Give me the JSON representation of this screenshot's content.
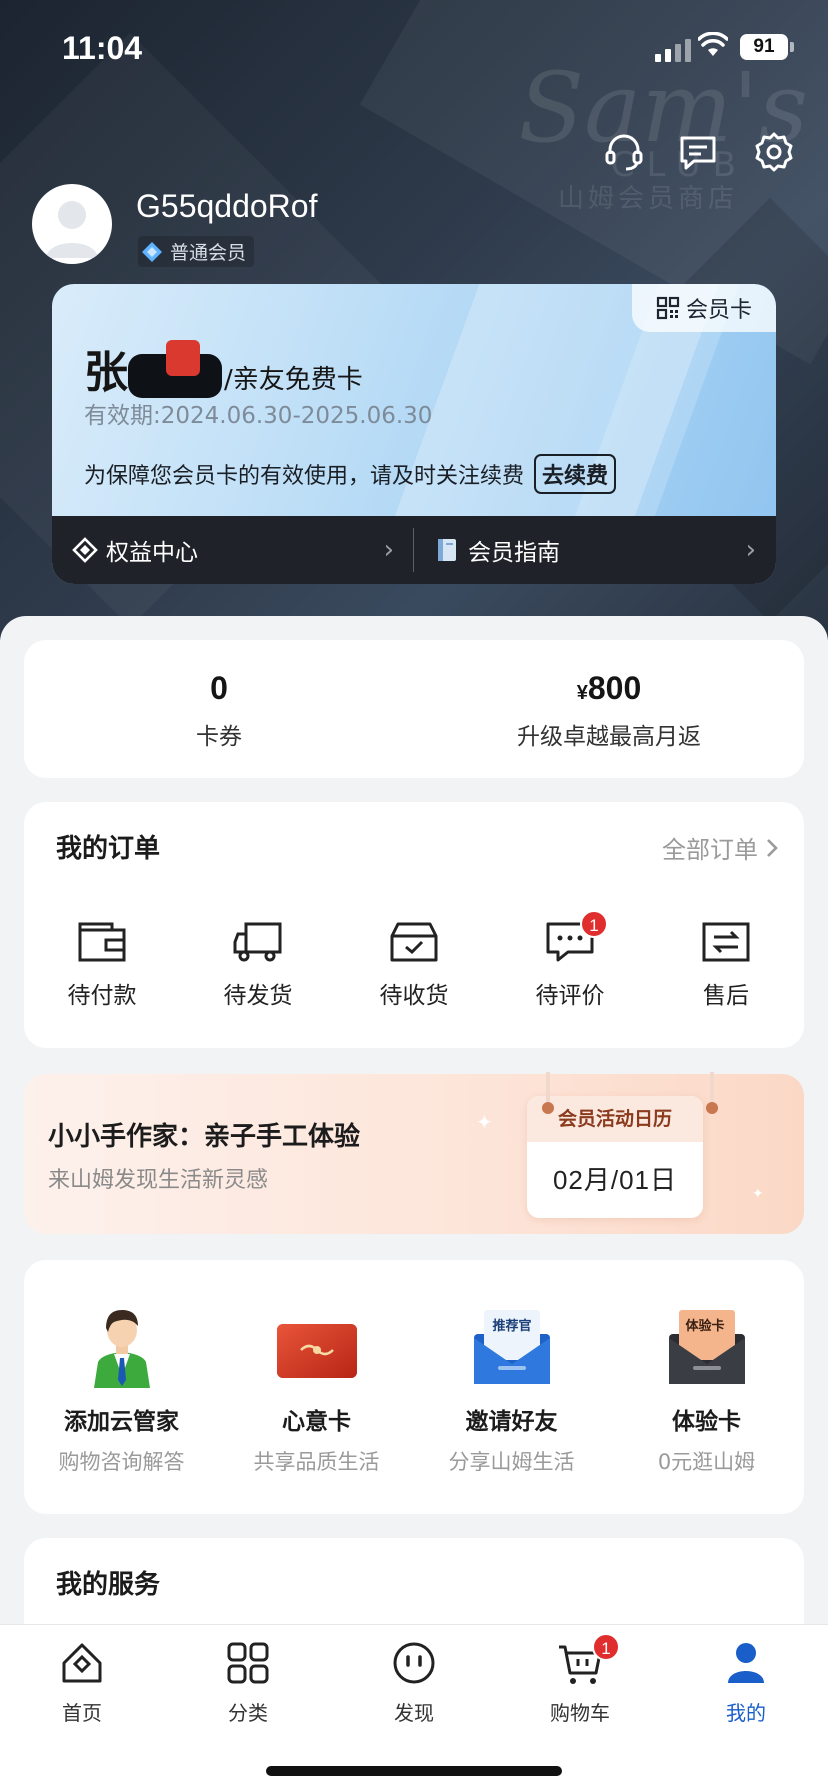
{
  "status_bar": {
    "time": "11:04",
    "battery": "91"
  },
  "header": {
    "brand_watermark": "Sam's",
    "brand_watermark_club": "CLUB",
    "brand_watermark_cn": "山姆会员商店",
    "icons": [
      "headset-icon",
      "message-icon",
      "settings-icon"
    ]
  },
  "profile": {
    "username": "G55qddoRof",
    "member_level": "普通会员"
  },
  "member_card": {
    "qr_label": "会员卡",
    "surname": "张",
    "card_type": "/亲友免费卡",
    "validity": "有效期:2024.06.30-2025.06.30",
    "renew_notice": "为保障您会员卡的有效使用，请及时关注续费",
    "renew_button": "去续费",
    "links": [
      {
        "label": "权益中心",
        "icon": "diamond-icon"
      },
      {
        "label": "会员指南",
        "icon": "book-icon"
      }
    ]
  },
  "stats": [
    {
      "value": "0",
      "currency": "",
      "label": "卡券"
    },
    {
      "value": "800",
      "currency": "¥",
      "label": "升级卓越最高月返"
    }
  ],
  "orders": {
    "title": "我的订单",
    "all_label": "全部订单",
    "items": [
      {
        "label": "待付款",
        "icon": "wallet-icon",
        "badge": ""
      },
      {
        "label": "待发货",
        "icon": "truck-icon",
        "badge": ""
      },
      {
        "label": "待收货",
        "icon": "box-check-icon",
        "badge": ""
      },
      {
        "label": "待评价",
        "icon": "comment-icon",
        "badge": "1"
      },
      {
        "label": "售后",
        "icon": "exchange-icon",
        "badge": ""
      }
    ]
  },
  "activity": {
    "title": "小小手作家：亲子手工体验",
    "subtitle": "来山姆发现生活新灵感",
    "calendar_label": "会员活动日历",
    "date": "02月/01日"
  },
  "services": [
    {
      "name": "添加云管家",
      "desc": "购物咨询解答",
      "icon": "assistant-avatar-icon"
    },
    {
      "name": "心意卡",
      "desc": "共享品质生活",
      "icon": "gift-card-icon"
    },
    {
      "name": "邀请好友",
      "desc": "分享山姆生活",
      "icon": "invite-envelope-icon",
      "tag": "推荐官"
    },
    {
      "name": "体验卡",
      "desc": "0元逛山姆",
      "icon": "trial-card-icon",
      "tag": "体验卡"
    }
  ],
  "my_services": {
    "title": "我的服务"
  },
  "tabbar": {
    "active": "我的",
    "items": [
      {
        "label": "首页",
        "icon": "home-icon",
        "badge": ""
      },
      {
        "label": "分类",
        "icon": "grid-icon",
        "badge": ""
      },
      {
        "label": "发现",
        "icon": "discover-face-icon",
        "badge": ""
      },
      {
        "label": "购物车",
        "icon": "cart-icon",
        "badge": "1"
      },
      {
        "label": "我的",
        "icon": "user-icon",
        "badge": ""
      }
    ]
  },
  "colors": {
    "accent": "#1a5fc9",
    "badge": "#e02e2e",
    "header_dark": "#1f2329"
  }
}
